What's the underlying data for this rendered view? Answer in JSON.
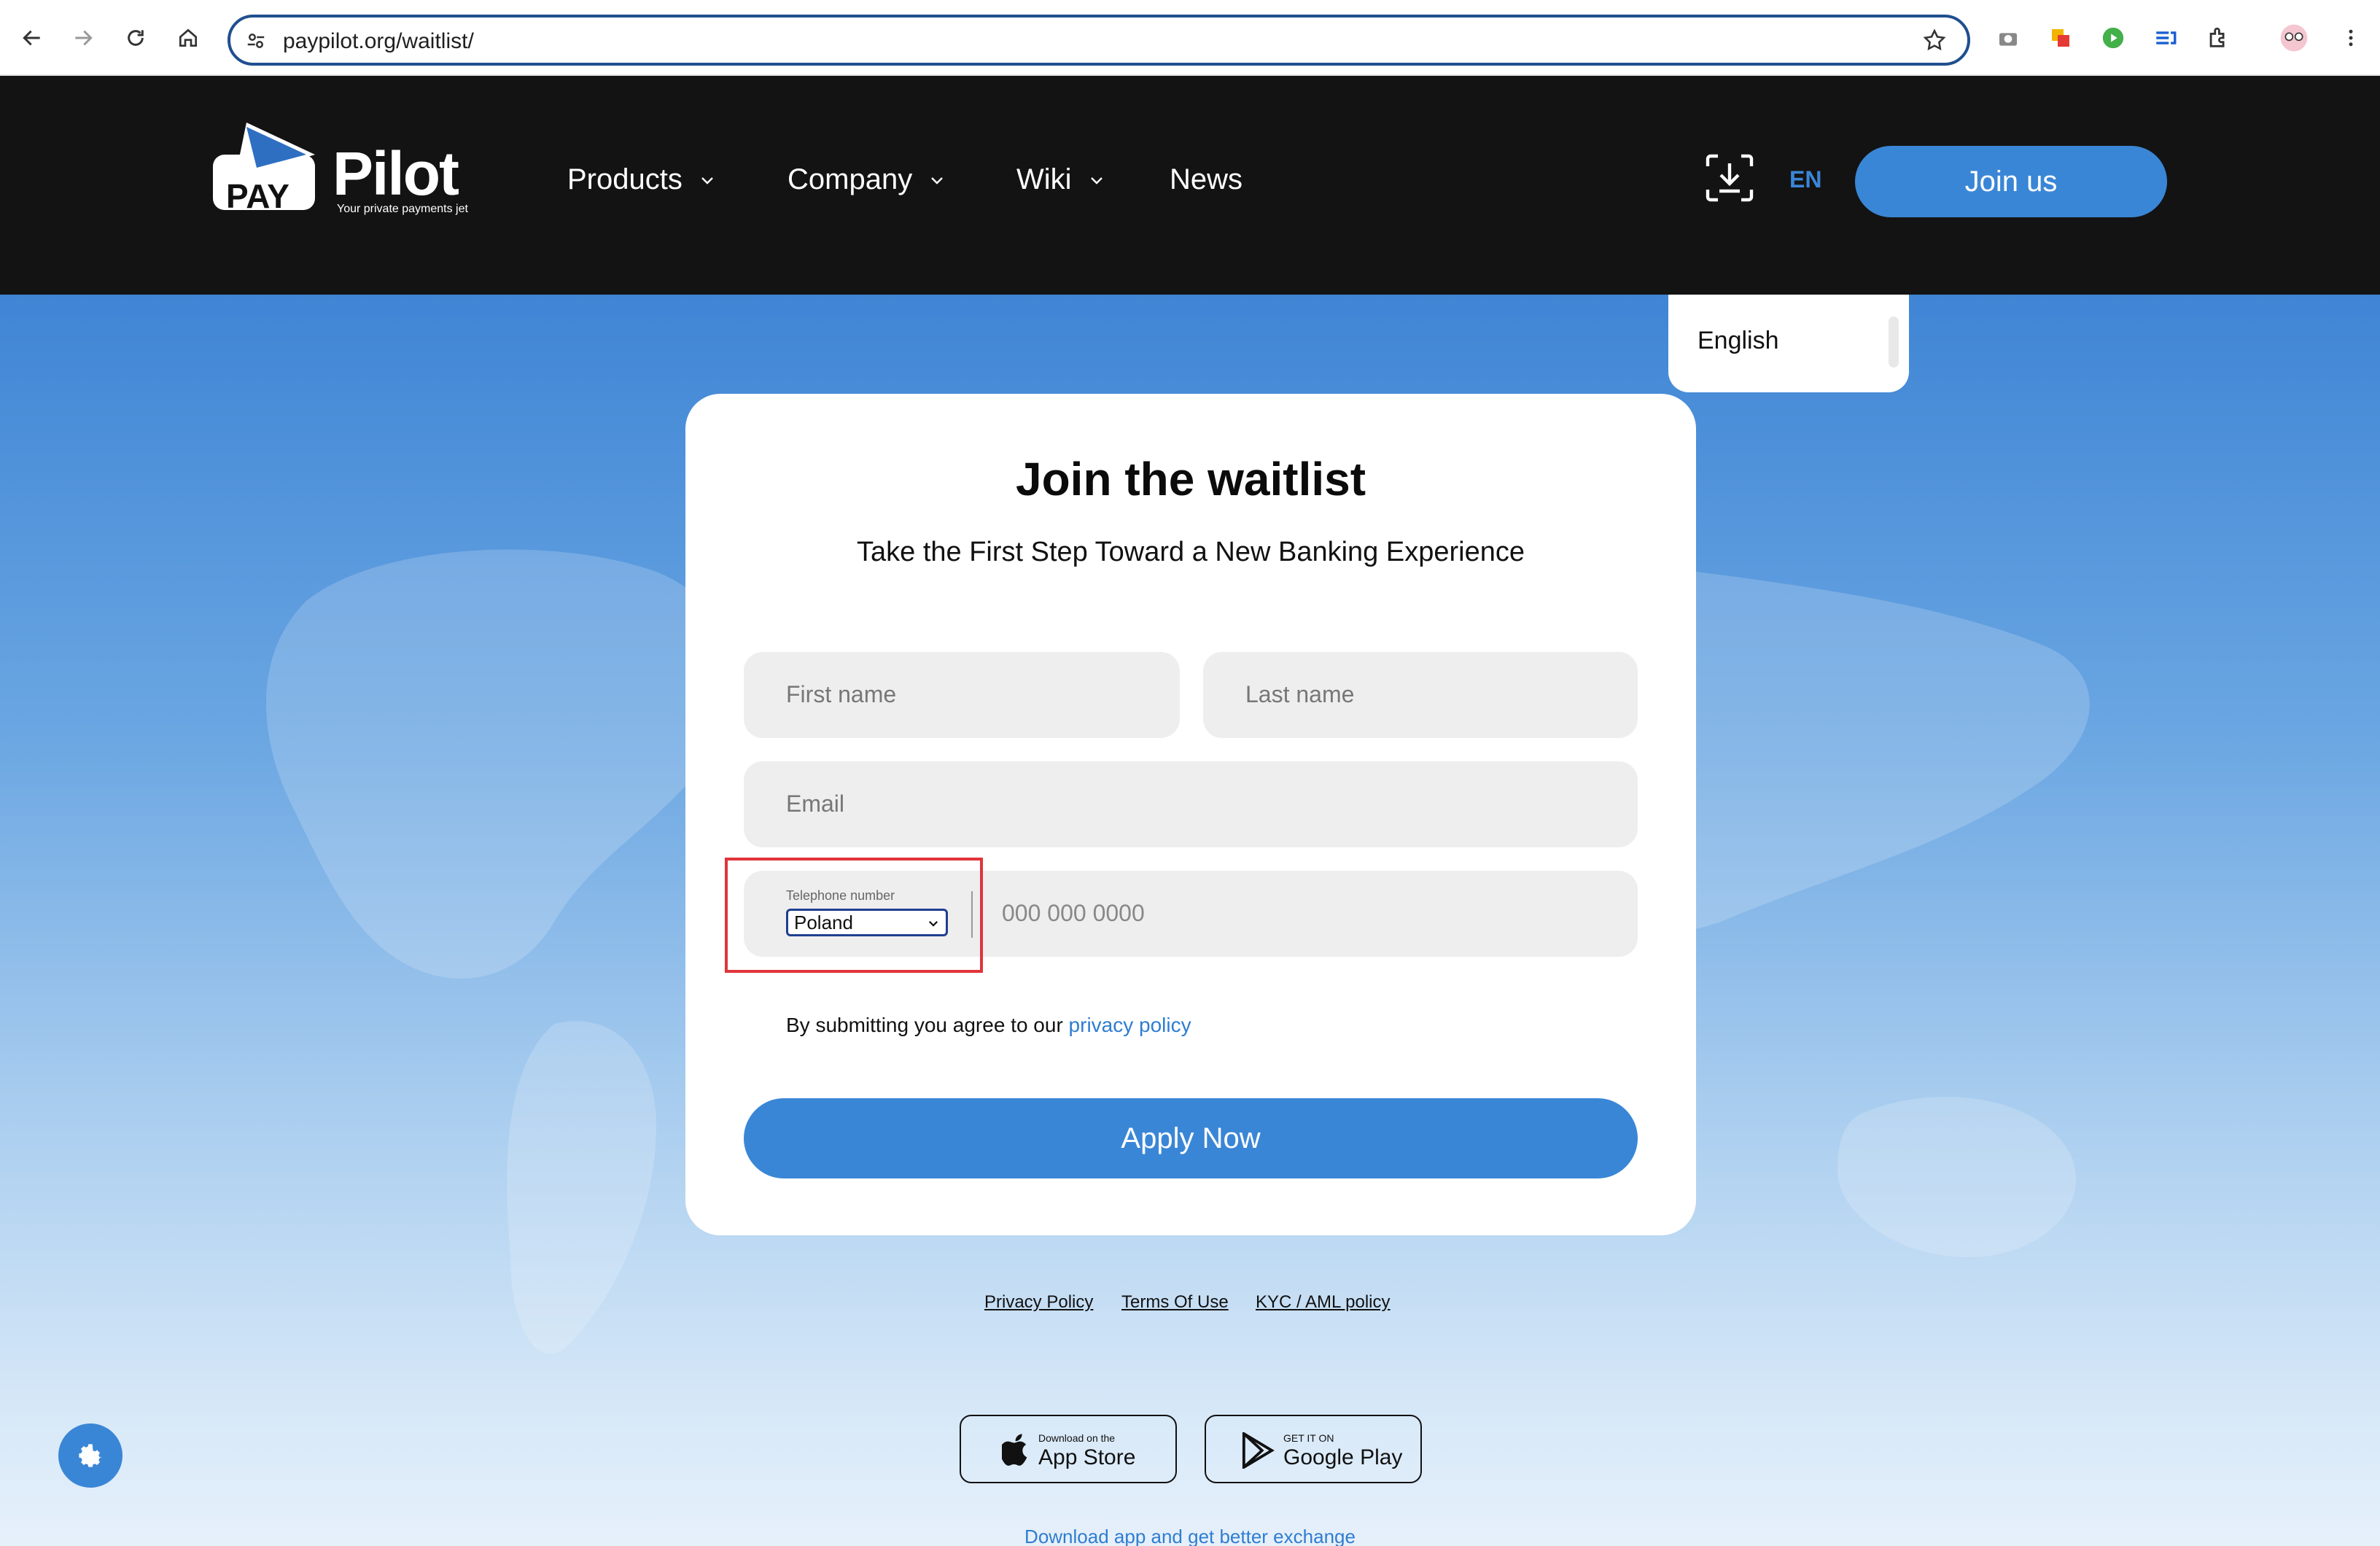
{
  "browser": {
    "url": "paypilot.org/waitlist/"
  },
  "header": {
    "logo_pay": "PAY",
    "logo_pilot": "Pilot",
    "logo_tagline": "Your private payments jet",
    "nav": [
      {
        "label": "Products"
      },
      {
        "label": "Company"
      },
      {
        "label": "Wiki"
      },
      {
        "label": "News"
      }
    ],
    "lang": "EN",
    "join_label": "Join us"
  },
  "language_dropdown": {
    "options": [
      "English"
    ]
  },
  "form": {
    "title": "Join the waitlist",
    "subtitle": "Take the First Step Toward a New Banking Experience",
    "first_name_placeholder": "First name",
    "last_name_placeholder": "Last name",
    "email_placeholder": "Email",
    "phone_label": "Telephone number",
    "country": "Poland",
    "phone_placeholder": "000 000 0000",
    "agree_text": "By submitting you agree to our",
    "privacy_link": "privacy policy",
    "apply_label": "Apply Now"
  },
  "footer": {
    "links": [
      "Privacy Policy",
      "Terms Of Use",
      "KYC / AML policy"
    ],
    "app_store_small": "Download on the",
    "app_store_big": "App Store",
    "google_small": "GET IT ON",
    "google_big": "Google Play",
    "download_text": "Download app and get better exchange"
  },
  "colors": {
    "accent": "#3a86d6",
    "header_bg": "#131313",
    "highlight": "#e0343a"
  }
}
